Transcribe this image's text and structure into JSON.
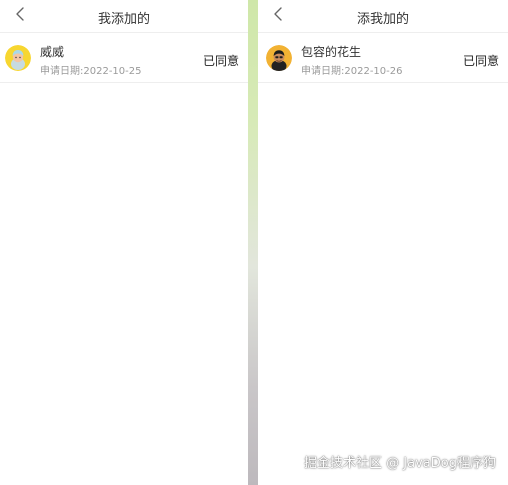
{
  "left_panel": {
    "title": "我添加的",
    "items": [
      {
        "name": "威威",
        "date": "申请日期:2022-10-25",
        "status": "已同意",
        "avatar_icon": "avatar-icon"
      }
    ]
  },
  "right_panel": {
    "title": "添我加的",
    "items": [
      {
        "name": "包容的花生",
        "date": "申请日期:2022-10-26",
        "status": "已同意",
        "avatar_icon": "avatar-icon"
      }
    ]
  },
  "watermark": "掘金技术社区 @ JavaDog程序狗",
  "colors": {
    "divider_top": "#cfe7a9",
    "divider_bottom": "#bdb9bd",
    "text_primary": "#333333",
    "text_secondary": "#9a9a9a"
  }
}
